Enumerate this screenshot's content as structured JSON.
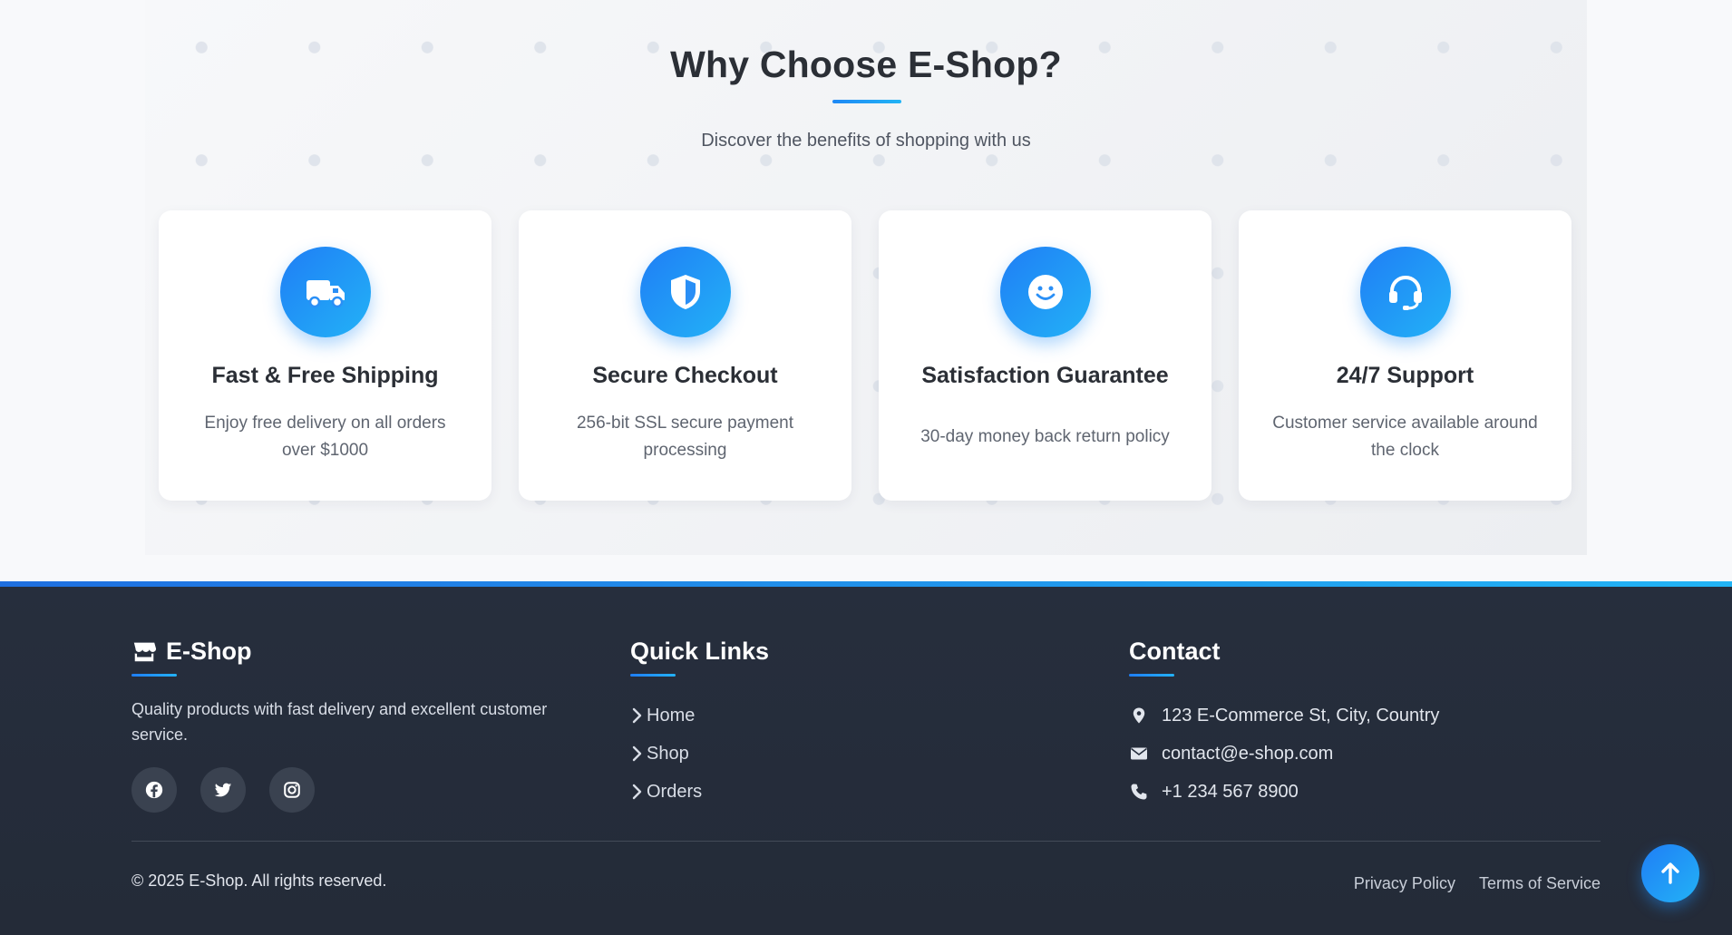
{
  "features": {
    "title": "Why Choose E-Shop?",
    "subtitle": "Discover the benefits of shopping with us",
    "cards": [
      {
        "icon": "truck-icon",
        "title": "Fast & Free Shipping",
        "text": "Enjoy free delivery on all orders over $1000"
      },
      {
        "icon": "shield-icon",
        "title": "Secure Checkout",
        "text": "256-bit SSL secure payment processing"
      },
      {
        "icon": "smile-icon",
        "title": "Satisfaction Guarantee",
        "text": "30-day money back return policy"
      },
      {
        "icon": "headset-icon",
        "title": "24/7 Support",
        "text": "Customer service available around the clock"
      }
    ]
  },
  "footer": {
    "brand": {
      "icon": "store-icon",
      "name": "E-Shop",
      "description": "Quality products with fast delivery and excellent customer service.",
      "socials": [
        "facebook-icon",
        "twitter-icon",
        "instagram-icon"
      ]
    },
    "quick_links": {
      "title": "Quick Links",
      "items": [
        "Home",
        "Shop",
        "Orders"
      ]
    },
    "contact": {
      "title": "Contact",
      "address": "123 E-Commerce St, City, Country",
      "email": "contact@e-shop.com",
      "phone": "+1 234 567 8900"
    },
    "copyright": "© 2025 E-Shop. All rights reserved.",
    "legal": {
      "privacy": "Privacy Policy",
      "terms": "Terms of Service"
    }
  },
  "colors": {
    "accent": "#1f7ef5",
    "accent_light": "#23b2f7",
    "footer_bg": "#262e3d"
  }
}
